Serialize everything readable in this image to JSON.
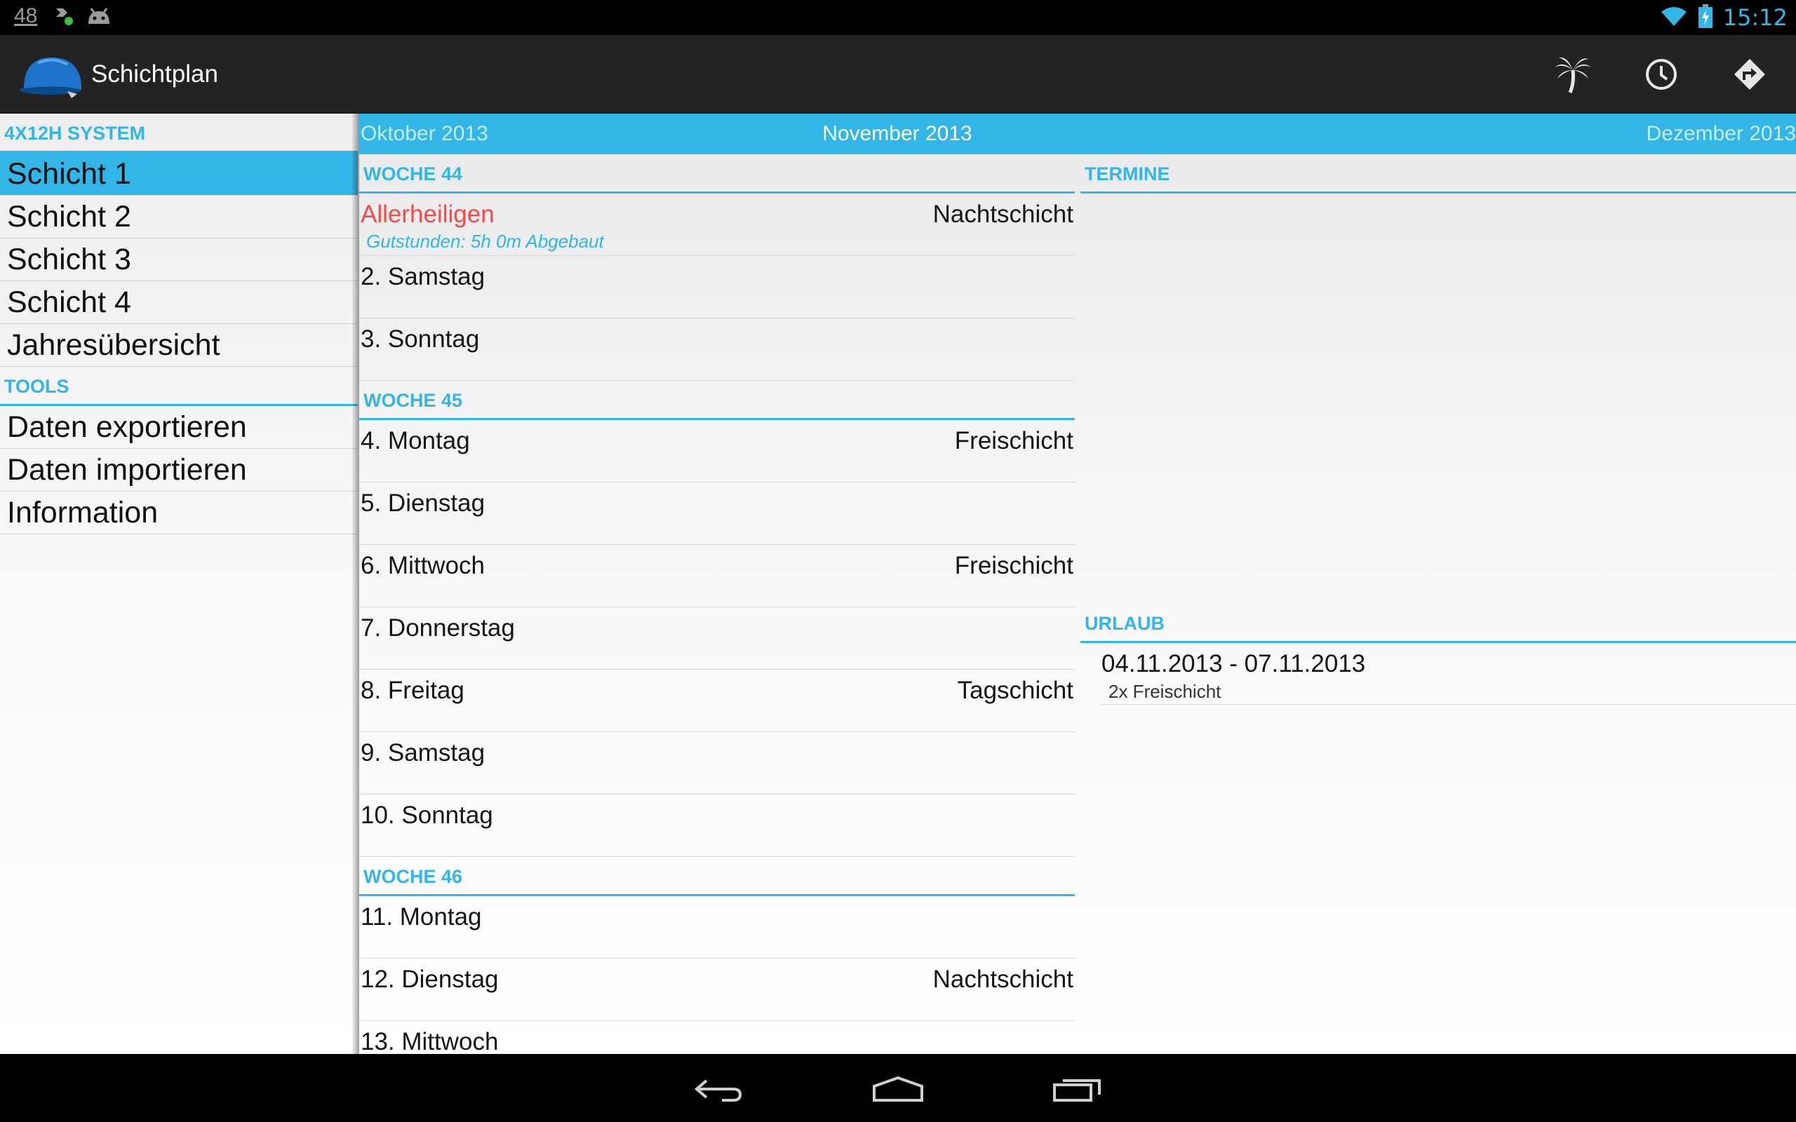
{
  "status_bar": {
    "notification_number": "48",
    "time": "15:12",
    "icons": [
      "download-notification-icon",
      "android-icon",
      "wifi-icon",
      "battery-charging-icon"
    ]
  },
  "action_bar": {
    "title": "Schichtplan",
    "logo": "blue-cap-logo",
    "actions": [
      "palm-tree-icon",
      "clock-icon",
      "directions-icon"
    ]
  },
  "sidebar": {
    "section1": "4X12H SYSTEM",
    "items": [
      "Schicht 1",
      "Schicht 2",
      "Schicht 3",
      "Schicht 4",
      "Jahresübersicht"
    ],
    "selected_index": 0,
    "section2": "TOOLS",
    "tools": [
      "Daten exportieren",
      "Daten importieren",
      "Information"
    ]
  },
  "months": {
    "prev": "Oktober 2013",
    "current": "November 2013",
    "next": "Dezember 2013"
  },
  "weeks": [
    {
      "label": "WOCHE 44",
      "days": [
        {
          "name": "Allerheiligen",
          "shift": "Nachtschicht",
          "note": "Gutstunden: 5h 0m Abgebaut",
          "holiday": true
        },
        {
          "name": "2. Samstag",
          "shift": ""
        },
        {
          "name": "3. Sonntag",
          "shift": ""
        }
      ]
    },
    {
      "label": "WOCHE 45",
      "days": [
        {
          "name": "4. Montag",
          "shift": "Freischicht"
        },
        {
          "name": "5. Dienstag",
          "shift": ""
        },
        {
          "name": "6. Mittwoch",
          "shift": "Freischicht"
        },
        {
          "name": "7. Donnerstag",
          "shift": ""
        },
        {
          "name": "8. Freitag",
          "shift": "Tagschicht"
        },
        {
          "name": "9. Samstag",
          "shift": ""
        },
        {
          "name": "10. Sonntag",
          "shift": ""
        }
      ]
    },
    {
      "label": "WOCHE 46",
      "days": [
        {
          "name": "11. Montag",
          "shift": ""
        },
        {
          "name": "12. Dienstag",
          "shift": "Nachtschicht"
        },
        {
          "name": "13. Mittwoch",
          "shift": ""
        }
      ]
    }
  ],
  "right_panel": {
    "termine_header": "TERMINE",
    "urlaub_header": "URLAUB",
    "urlaub": [
      {
        "range": "04.11.2013 - 07.11.2013",
        "detail": "2x Freischicht"
      }
    ]
  },
  "nav_bar": {
    "buttons": [
      "back-icon",
      "home-icon",
      "recent-apps-icon"
    ]
  },
  "colors": {
    "accent": "#33b5e5",
    "holiday": "#f44a4a",
    "actionbar": "#232323"
  }
}
